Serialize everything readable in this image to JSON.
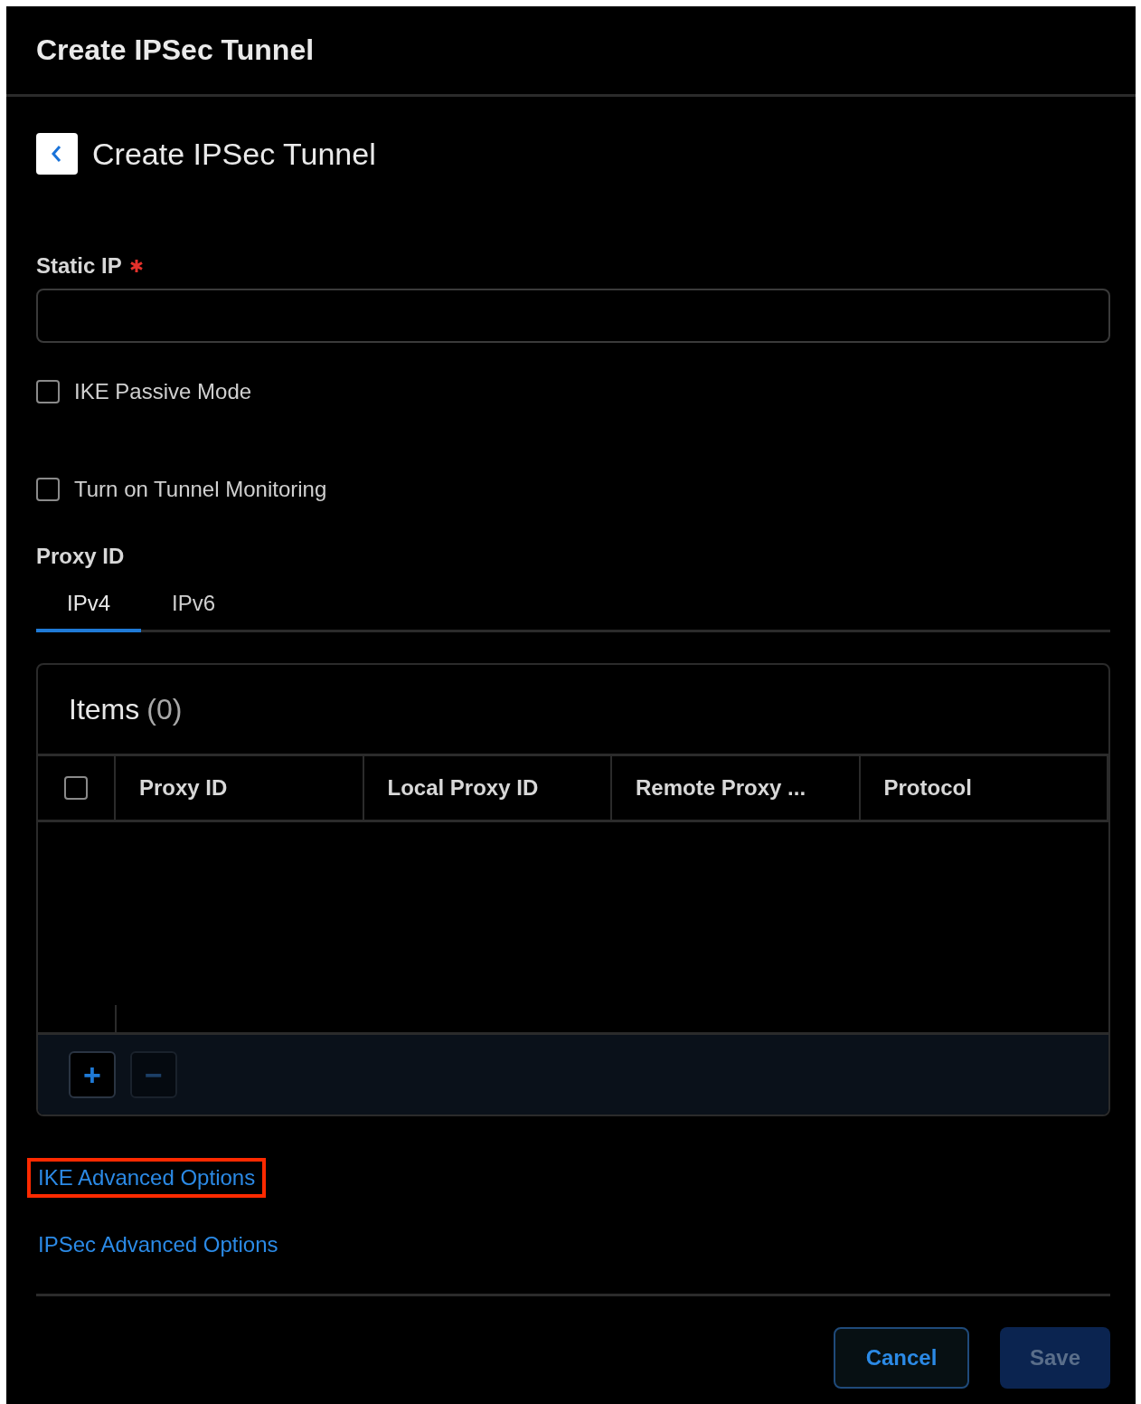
{
  "dialog": {
    "title": "Create IPSec Tunnel"
  },
  "page": {
    "title": "Create IPSec Tunnel"
  },
  "static_ip": {
    "label": "Static IP",
    "required": true
  },
  "options": [
    {
      "label": "IKE Passive Mode",
      "checked": false
    },
    {
      "label": "Turn on Tunnel Monitoring",
      "checked": false
    }
  ],
  "proxy_id": {
    "label": "Proxy ID",
    "tabs": [
      {
        "label": "IPv4",
        "selected": true
      },
      {
        "label": "IPv6",
        "selected": false
      }
    ]
  },
  "items_table": {
    "title": "Items",
    "count": "(0)",
    "select_all": false,
    "columns": [
      "Proxy ID",
      "Local Proxy ID",
      "Remote Proxy ...",
      "Protocol"
    ],
    "add_button": {
      "label": "+",
      "disabled": false
    },
    "remove_button": {
      "label": "−",
      "disabled": true
    }
  },
  "links": [
    {
      "label": "IKE Advanced Options",
      "highlighted": true
    },
    {
      "label": "IPSec Advanced Options",
      "highlighted": false
    }
  ],
  "buttons": [
    {
      "label": "Cancel",
      "kind": "secondary",
      "disabled": false
    },
    {
      "label": "Save",
      "kind": "primary",
      "disabled": true
    }
  ]
}
